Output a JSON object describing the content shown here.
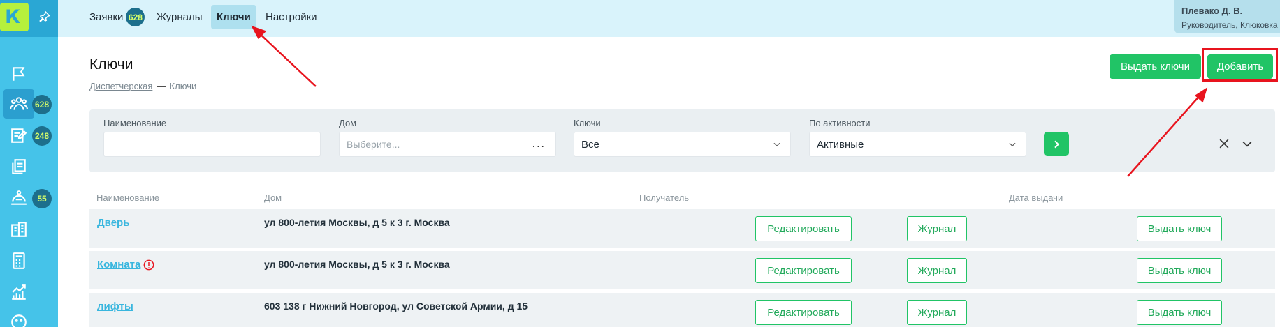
{
  "sidebar": {
    "logo_letter": "К",
    "items": [
      {
        "icon": "flag-icon"
      },
      {
        "icon": "people-icon",
        "badge": "628",
        "active": true
      },
      {
        "icon": "edit-note-icon",
        "badge": "248"
      },
      {
        "icon": "documents-icon"
      },
      {
        "icon": "service-bell-icon",
        "badge": "55"
      },
      {
        "icon": "building-icon"
      },
      {
        "icon": "calculator-icon"
      },
      {
        "icon": "chart-icon"
      },
      {
        "icon": "smile-icon"
      }
    ]
  },
  "topnav": {
    "items": [
      {
        "label": "Заявки",
        "badge": "628"
      },
      {
        "label": "Журналы"
      },
      {
        "label": "Ключи",
        "active": true
      },
      {
        "label": "Настройки"
      }
    ]
  },
  "user": {
    "name": "Плевако Д. В.",
    "role": "Руководитель, Клюковка"
  },
  "page": {
    "title": "Ключи",
    "breadcrumb": {
      "link": "Диспетчерская",
      "separator": "—",
      "current": "Ключи"
    },
    "issue_keys_label": "Выдать ключи",
    "add_label": "Добавить"
  },
  "filters": {
    "name": {
      "label": "Наименование",
      "value": ""
    },
    "house": {
      "label": "Дом",
      "placeholder": "Выберите...",
      "more": "..."
    },
    "keys": {
      "label": "Ключи",
      "value": "Все"
    },
    "activity": {
      "label": "По активности",
      "value": "Активные"
    }
  },
  "table": {
    "headers": [
      "Наименование",
      "Дом",
      "Получатель",
      "Дата выдачи"
    ],
    "edit_label": "Редактировать",
    "journal_label": "Журнал",
    "issue_label": "Выдать ключ",
    "rows": [
      {
        "name": "Дверь",
        "house": "ул 800-летия Москвы, д 5 к 3 г. Москва",
        "warning": false
      },
      {
        "name": "Комната",
        "house": "ул 800-летия Москвы, д 5 к 3 г. Москва",
        "warning": true
      },
      {
        "name": "лифты",
        "house": "603 138 г Нижний Новгород, ул Советской Армии, д 15",
        "warning": false
      }
    ]
  },
  "colors": {
    "sidebar": "#45c3e9",
    "topbar": "#d9f3fb",
    "accent_green": "#21c466",
    "badge": "#1d6f8c",
    "annotation_red": "#e8141e"
  }
}
